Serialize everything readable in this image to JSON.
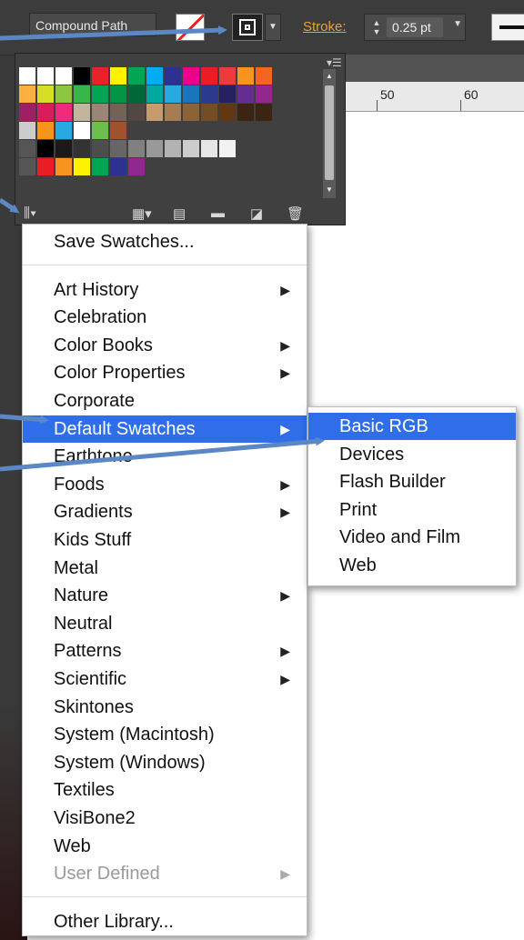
{
  "control_bar": {
    "object_type": "Compound Path",
    "stroke_label": "Stroke:",
    "stroke_weight": "0.25 pt"
  },
  "ruler": {
    "ticks": [
      "50",
      "60"
    ]
  },
  "swatches_panel": {
    "rows": [
      [
        "#ffffff",
        "#ffffff",
        "#ffffff",
        "#000000",
        "#e9212a",
        "#fff200",
        "#00a651",
        "#00aeef",
        "#2e3192",
        "#ec008c",
        "#ed1c24",
        "#ed3a3a",
        "#f7941d",
        "#f26522"
      ],
      [
        "#fbb040",
        "#d7df23",
        "#8dc63f",
        "#39b54a",
        "#00a651",
        "#009444",
        "#006838",
        "#00a99d",
        "#27aae1",
        "#1c75bc",
        "#2b3990",
        "#262262",
        "#662d91",
        "#92278f"
      ],
      [
        "#9e1f63",
        "#da1c5c",
        "#ee2a7b",
        "#c2b59b",
        "#998675",
        "#736357",
        "#534741",
        "#c69c6d",
        "#a67c52",
        "#8c6239",
        "#754c24",
        "#603813",
        "#3c2415",
        "#3c2415"
      ],
      [
        "#cccccc",
        "#f7941d",
        "#27aae1",
        "#ffffff",
        "#6cbf4b",
        "#a0522d"
      ],
      [
        "#555555",
        "#000000",
        "#1a1a1a",
        "#333333",
        "#4d4d4d",
        "#666666",
        "#808080",
        "#999999",
        "#b3b3b3",
        "#cccccc",
        "#e6e6e6",
        "#f2f2f2"
      ],
      [
        "#555555",
        "#ed1c24",
        "#f7941d",
        "#fff200",
        "#00a651",
        "#2e3192",
        "#92278f"
      ]
    ]
  },
  "menu": {
    "items": [
      {
        "label": "Save Swatches...",
        "arrow": ""
      },
      {
        "label": "Art History",
        "arrow": "▶"
      },
      {
        "label": "Celebration",
        "arrow": ""
      },
      {
        "label": "Color Books",
        "arrow": "▶"
      },
      {
        "label": "Color Properties",
        "arrow": "▶"
      },
      {
        "label": "Corporate",
        "arrow": ""
      },
      {
        "label": "Default Swatches",
        "arrow": "▶"
      },
      {
        "label": "Earthtone",
        "arrow": ""
      },
      {
        "label": "Foods",
        "arrow": "▶"
      },
      {
        "label": "Gradients",
        "arrow": "▶"
      },
      {
        "label": "Kids Stuff",
        "arrow": ""
      },
      {
        "label": "Metal",
        "arrow": ""
      },
      {
        "label": "Nature",
        "arrow": "▶"
      },
      {
        "label": "Neutral",
        "arrow": ""
      },
      {
        "label": "Patterns",
        "arrow": "▶"
      },
      {
        "label": "Scientific",
        "arrow": "▶"
      },
      {
        "label": "Skintones",
        "arrow": ""
      },
      {
        "label": "System (Macintosh)",
        "arrow": ""
      },
      {
        "label": "System (Windows)",
        "arrow": ""
      },
      {
        "label": "Textiles",
        "arrow": ""
      },
      {
        "label": "VisiBone2",
        "arrow": ""
      },
      {
        "label": "Web",
        "arrow": ""
      },
      {
        "label": "User Defined",
        "arrow": "▶"
      },
      {
        "label": "Other Library...",
        "arrow": ""
      }
    ]
  },
  "submenu": {
    "items": [
      "Basic RGB",
      "Devices",
      "Flash Builder",
      "Print",
      "Video and Film",
      "Web"
    ]
  },
  "colors": {
    "highlight": "#2f6ee8",
    "arrow": "#5b87c5",
    "stroke_label": "#e8a13a"
  }
}
